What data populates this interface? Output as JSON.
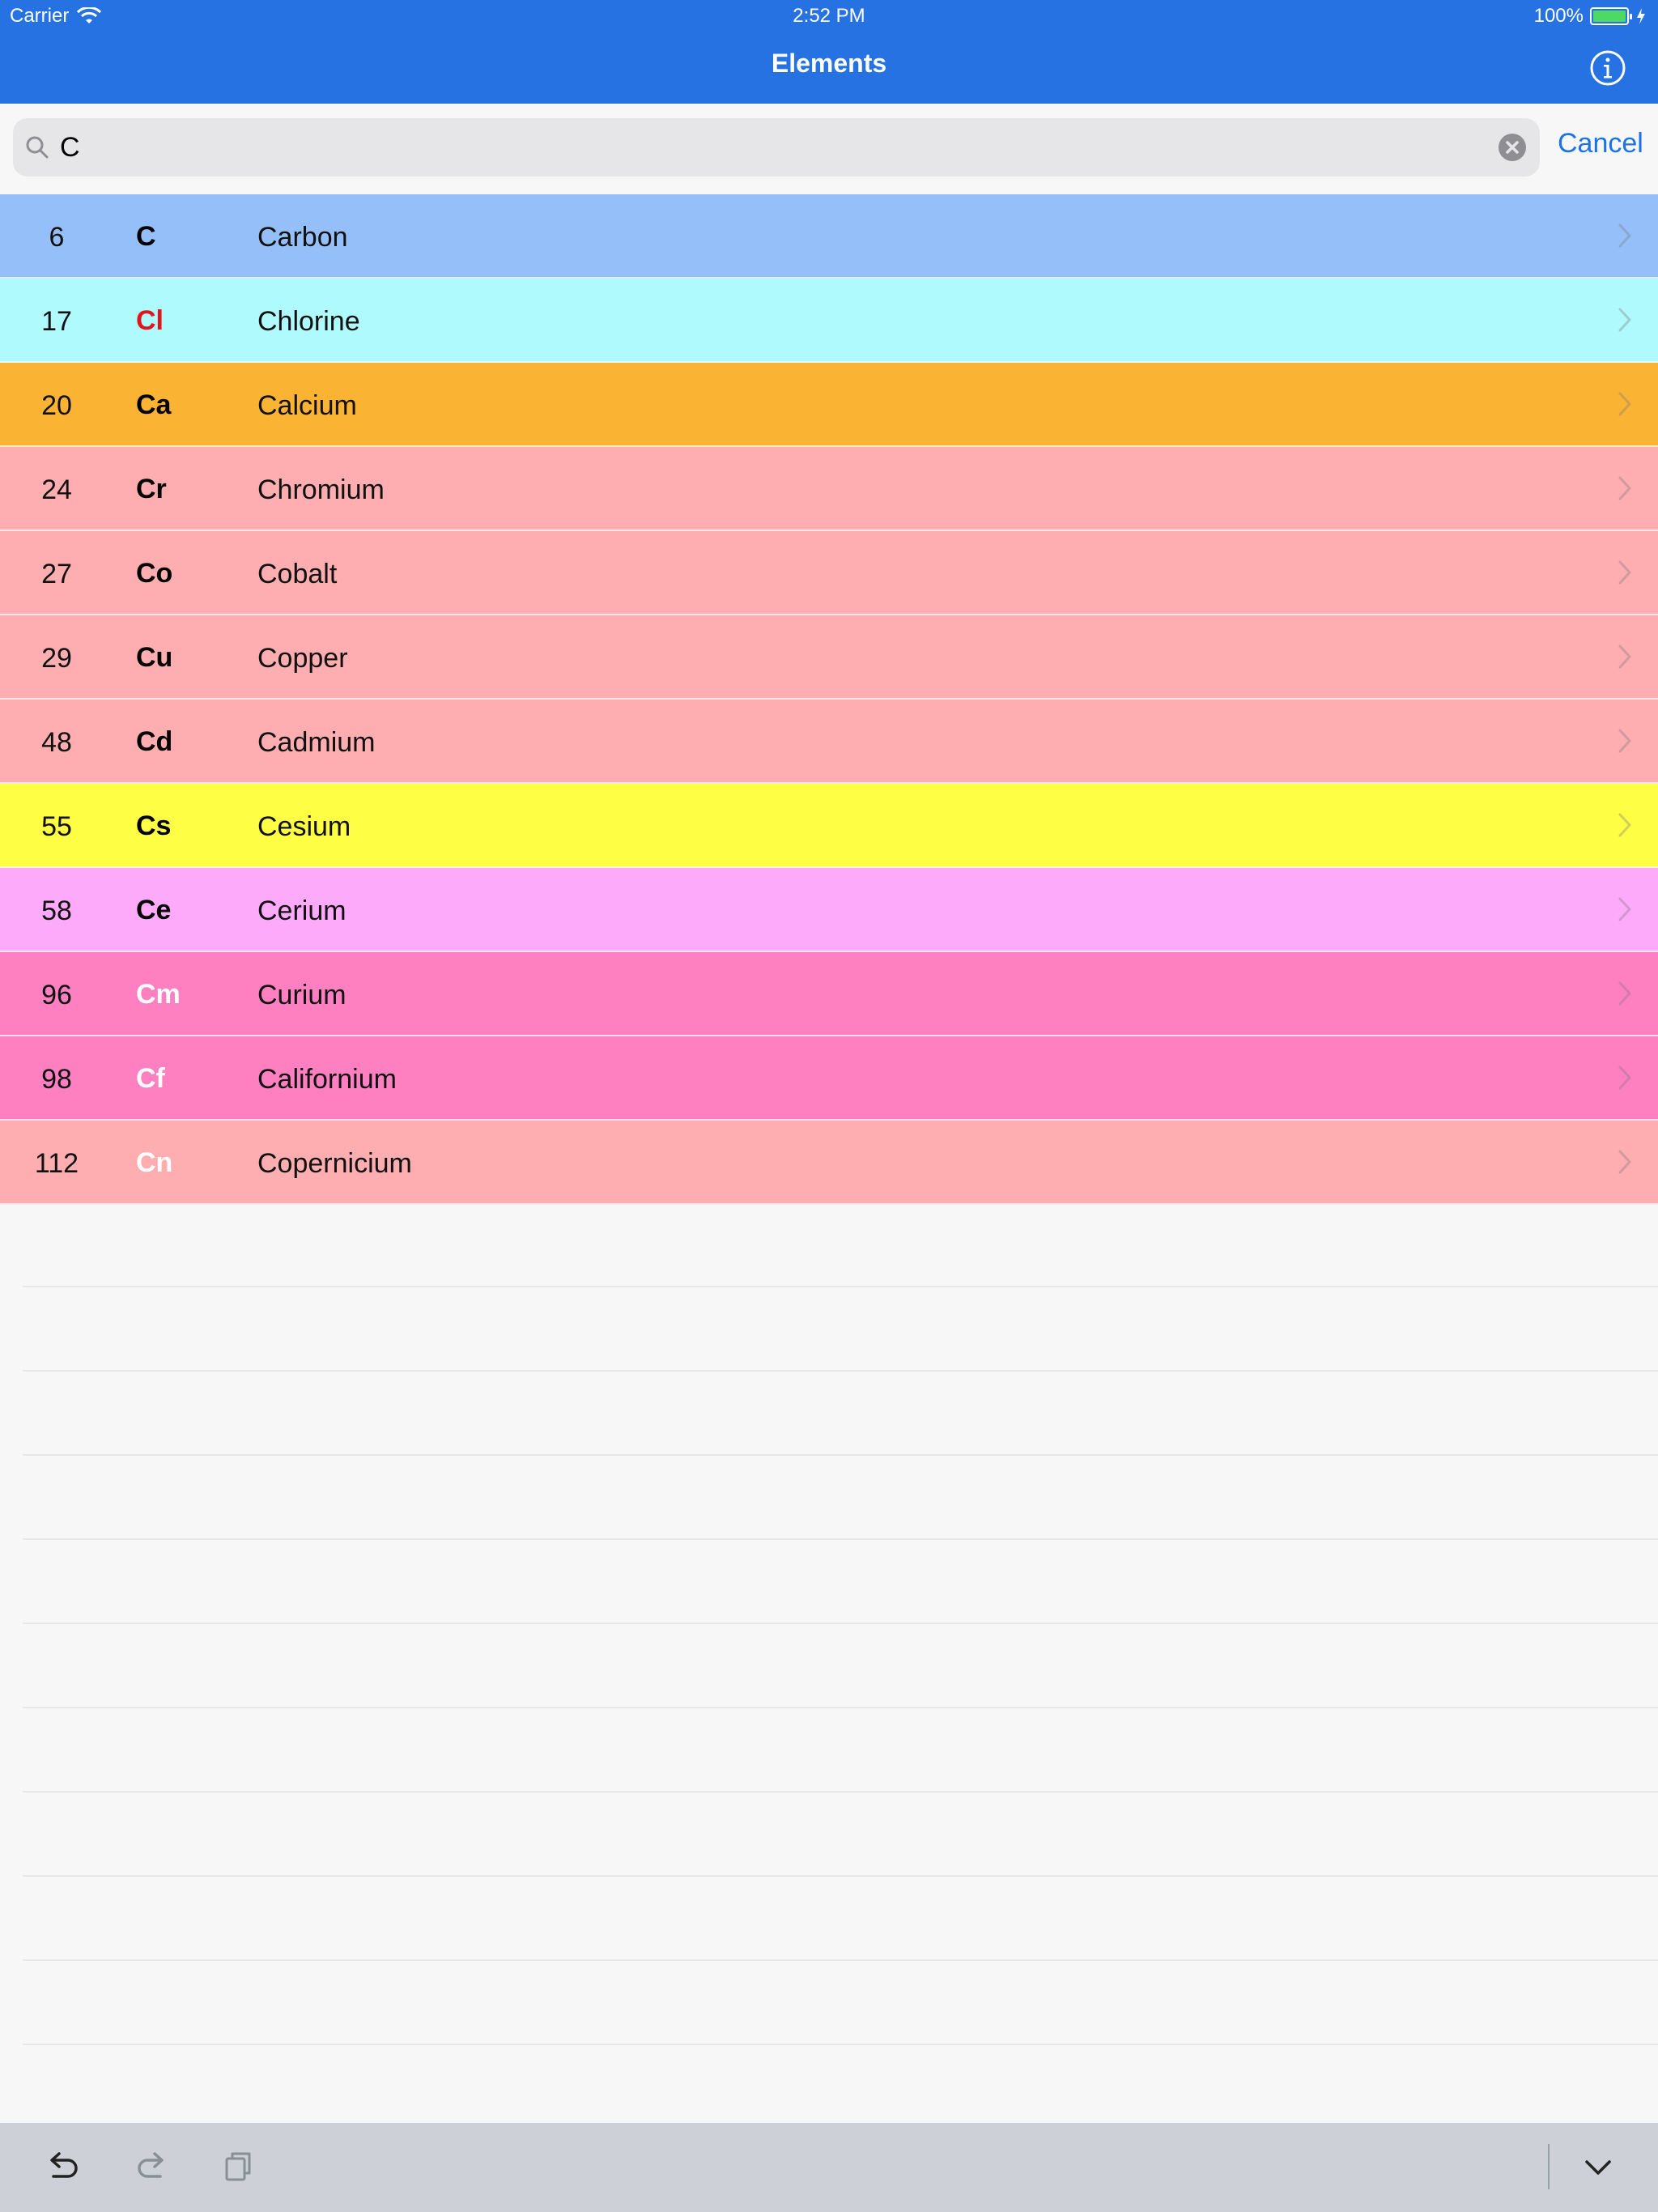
{
  "status_bar": {
    "carrier": "Carrier",
    "time": "2:52 PM",
    "battery": "100%"
  },
  "nav": {
    "title": "Elements",
    "info_icon": "info-circle-icon"
  },
  "search": {
    "value": "C",
    "cancel_label": "Cancel"
  },
  "elements": [
    {
      "number": "6",
      "symbol": "C",
      "name": "Carbon",
      "row_color": "#95bff9",
      "symbol_color": "#000000"
    },
    {
      "number": "17",
      "symbol": "Cl",
      "name": "Chlorine",
      "row_color": "#affafc",
      "symbol_color": "#e0161c"
    },
    {
      "number": "20",
      "symbol": "Ca",
      "name": "Calcium",
      "row_color": "#fbb334",
      "symbol_color": "#000000"
    },
    {
      "number": "24",
      "symbol": "Cr",
      "name": "Chromium",
      "row_color": "#feaeb0",
      "symbol_color": "#000000"
    },
    {
      "number": "27",
      "symbol": "Co",
      "name": "Cobalt",
      "row_color": "#feaeb0",
      "symbol_color": "#000000"
    },
    {
      "number": "29",
      "symbol": "Cu",
      "name": "Copper",
      "row_color": "#feaeb0",
      "symbol_color": "#000000"
    },
    {
      "number": "48",
      "symbol": "Cd",
      "name": "Cadmium",
      "row_color": "#feaeb0",
      "symbol_color": "#000000"
    },
    {
      "number": "55",
      "symbol": "Cs",
      "name": "Cesium",
      "row_color": "#fefe44",
      "symbol_color": "#000000"
    },
    {
      "number": "58",
      "symbol": "Ce",
      "name": "Cerium",
      "row_color": "#feaafb",
      "symbol_color": "#000000"
    },
    {
      "number": "96",
      "symbol": "Cm",
      "name": "Curium",
      "row_color": "#fe80c0",
      "symbol_color": "#ffffff"
    },
    {
      "number": "98",
      "symbol": "Cf",
      "name": "Californium",
      "row_color": "#fe80c0",
      "symbol_color": "#ffffff"
    },
    {
      "number": "112",
      "symbol": "Cn",
      "name": "Copernicium",
      "row_color": "#feaeb0",
      "symbol_color": "#ffffff"
    }
  ],
  "keyboard_toolbar": {
    "undo_icon": "undo-icon",
    "redo_icon": "redo-icon",
    "paste_icon": "paste-icon",
    "dismiss_icon": "chevron-down-icon"
  },
  "colors": {
    "accent": "#2672e3",
    "link": "#1a73e8"
  }
}
